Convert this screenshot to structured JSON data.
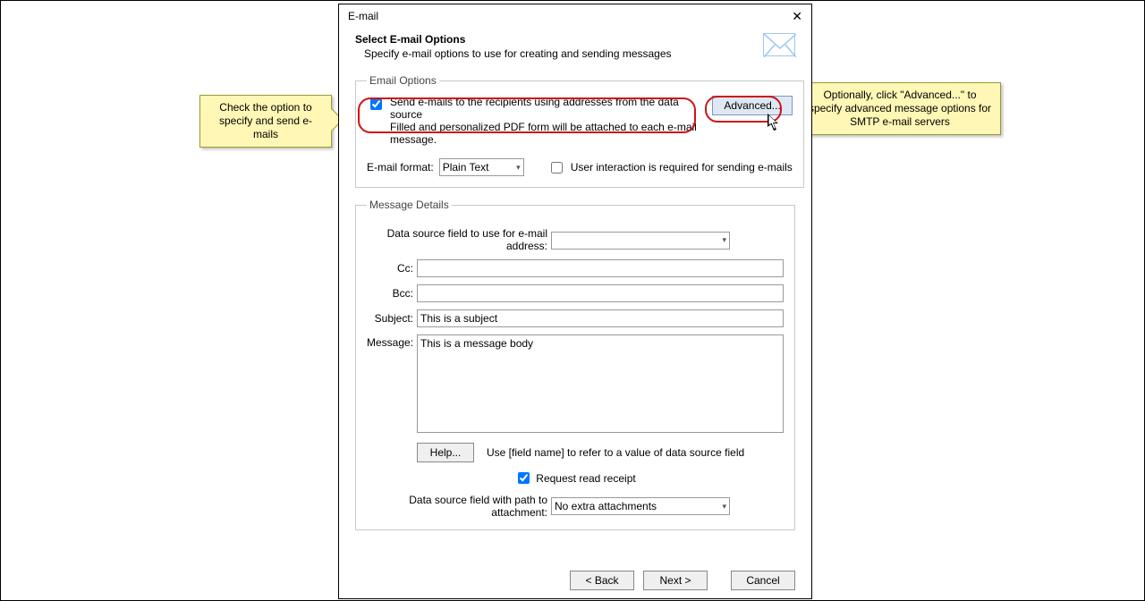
{
  "window": {
    "title": "E-mail",
    "header_title": "Select E-mail Options",
    "header_subtitle": "Specify e-mail options to use for creating and sending messages"
  },
  "email_options": {
    "legend": "Email Options",
    "send_checked": true,
    "send_label": "Send e-mails to the recipients using addresses from the data source",
    "send_sub": "Filled and personalized PDF form will be attached to each e-mail message.",
    "advanced_label": "Advanced...",
    "format_label": "E-mail format:",
    "format_value": "Plain Text",
    "interaction_checked": false,
    "interaction_label": "User interaction is required for sending e-mails"
  },
  "message_details": {
    "legend": "Message Details",
    "addr_field_label": "Data source field to use for e-mail address:",
    "addr_field_value": "",
    "cc_label": "Cc:",
    "cc_value": "",
    "bcc_label": "Bcc:",
    "bcc_value": "",
    "subject_label": "Subject:",
    "subject_value": "This is a subject",
    "message_label": "Message:",
    "message_value": "This is a message body",
    "help_label": "Help...",
    "help_hint": "Use [field name] to refer to a value of data source field",
    "receipt_checked": true,
    "receipt_label": "Request read receipt",
    "attach_label": "Data source field with path to attachment:",
    "attach_value": "No extra attachments"
  },
  "buttons": {
    "back": "< Back",
    "next": "Next >",
    "cancel": "Cancel"
  },
  "callouts": {
    "left": "Check the option to specify and send e-mails",
    "right": "Optionally, click \"Advanced...\" to specify advanced message options for SMTP e-mail servers"
  }
}
